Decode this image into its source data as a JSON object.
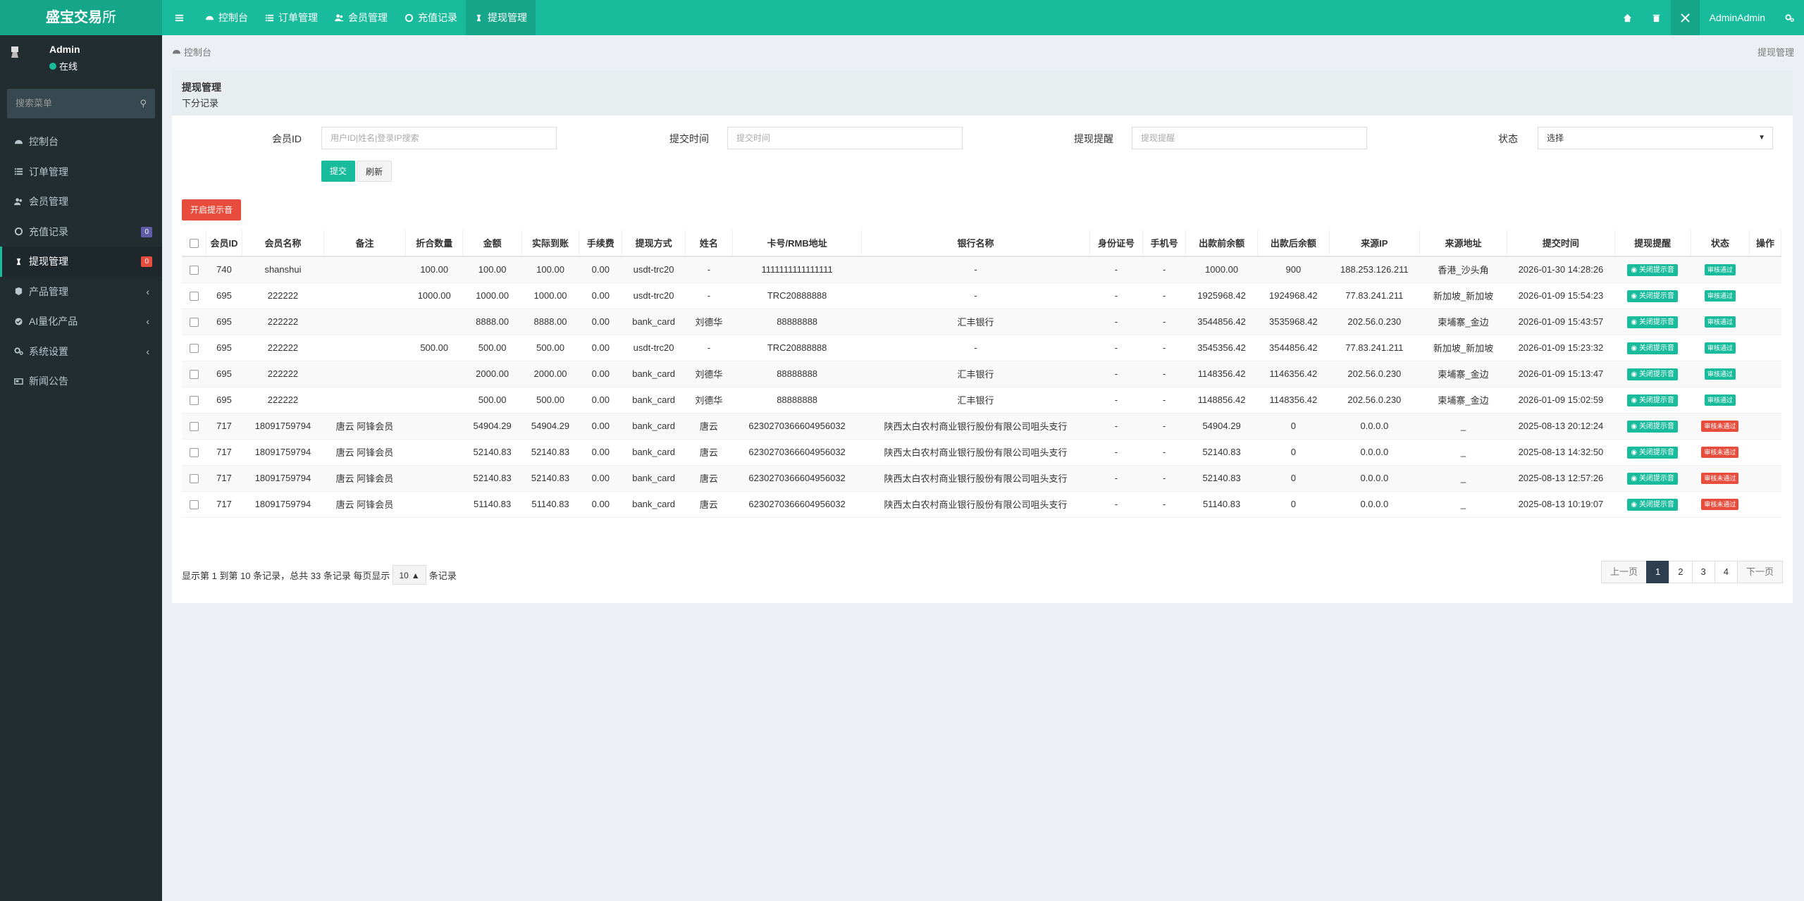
{
  "header": {
    "brand_bold": "盛宝交易",
    "brand_light": "所",
    "nav": [
      "控制台",
      "订单管理",
      "会员管理",
      "充值记录",
      "提现管理"
    ],
    "right_user": "AdminAdmin"
  },
  "sidebar": {
    "user_name": "Admin",
    "status": "在线",
    "search_placeholder": "搜索菜单",
    "items": [
      {
        "label": "控制台"
      },
      {
        "label": "订单管理"
      },
      {
        "label": "会员管理"
      },
      {
        "label": "充值记录",
        "badge": "0",
        "badge_color": "#605ca8"
      },
      {
        "label": "提现管理",
        "badge": "0",
        "badge_color": "#e74c3c"
      },
      {
        "label": "产品管理"
      },
      {
        "label": "AI量化产品"
      },
      {
        "label": "系统设置"
      },
      {
        "label": "新闻公告"
      }
    ]
  },
  "breadcrumb": {
    "home": "控制台",
    "current": "提现管理"
  },
  "panel": {
    "title": "提现管理",
    "subtitle": "下分记录"
  },
  "filters": {
    "member_id_label": "会员ID",
    "member_id_placeholder": "用户ID|姓名|登录IP搜索",
    "time_label": "提交时间",
    "time_placeholder": "提交时间",
    "remind_label": "提现提醒",
    "remind_placeholder": "提现提醒",
    "status_label": "状态",
    "status_value": "选择",
    "submit": "提交",
    "refresh": "刷新"
  },
  "alert_button": "开启提示音",
  "table": {
    "headers": [
      "会员ID",
      "会员名称",
      "备注",
      "折合数量",
      "金额",
      "实际到账",
      "手续费",
      "提现方式",
      "姓名",
      "卡号/RMB地址",
      "银行名称",
      "身份证号",
      "手机号",
      "出款前余额",
      "出款后余额",
      "来源IP",
      "来源地址",
      "提交时间",
      "提现提醒",
      "状态",
      "操作"
    ],
    "remind_label": "关闭提示音",
    "rows": [
      {
        "id": "740",
        "name": "shanshui",
        "note": "",
        "convert": "100.00",
        "amount": "100.00",
        "actual": "100.00",
        "fee": "0.00",
        "method": "usdt-trc20",
        "realname": "-",
        "card": "1111111111111111",
        "bank": "-",
        "idcard": "-",
        "phone": "-",
        "before": "1000.00",
        "after": "900",
        "ip": "188.253.126.211",
        "addr": "香港_沙头角",
        "time": "2026-01-30 14:28:26",
        "status": "审核通过",
        "status_type": "ok"
      },
      {
        "id": "695",
        "name": "222222",
        "note": "",
        "convert": "1000.00",
        "amount": "1000.00",
        "actual": "1000.00",
        "fee": "0.00",
        "method": "usdt-trc20",
        "realname": "-",
        "card": "TRC20888888",
        "bank": "-",
        "idcard": "-",
        "phone": "-",
        "before": "1925968.42",
        "after": "1924968.42",
        "ip": "77.83.241.211",
        "addr": "新加坡_新加坡",
        "time": "2026-01-09 15:54:23",
        "status": "审核通过",
        "status_type": "ok"
      },
      {
        "id": "695",
        "name": "222222",
        "note": "",
        "convert": "",
        "amount": "8888.00",
        "actual": "8888.00",
        "fee": "0.00",
        "method": "bank_card",
        "realname": "刘德华",
        "card": "88888888",
        "bank": "汇丰银行",
        "idcard": "-",
        "phone": "-",
        "before": "3544856.42",
        "after": "3535968.42",
        "ip": "202.56.0.230",
        "addr": "柬埔寨_金边",
        "time": "2026-01-09 15:43:57",
        "status": "审核通过",
        "status_type": "ok"
      },
      {
        "id": "695",
        "name": "222222",
        "note": "",
        "convert": "500.00",
        "amount": "500.00",
        "actual": "500.00",
        "fee": "0.00",
        "method": "usdt-trc20",
        "realname": "-",
        "card": "TRC20888888",
        "bank": "-",
        "idcard": "-",
        "phone": "-",
        "before": "3545356.42",
        "after": "3544856.42",
        "ip": "77.83.241.211",
        "addr": "新加坡_新加坡",
        "time": "2026-01-09 15:23:32",
        "status": "审核通过",
        "status_type": "ok"
      },
      {
        "id": "695",
        "name": "222222",
        "note": "",
        "convert": "",
        "amount": "2000.00",
        "actual": "2000.00",
        "fee": "0.00",
        "method": "bank_card",
        "realname": "刘德华",
        "card": "88888888",
        "bank": "汇丰银行",
        "idcard": "-",
        "phone": "-",
        "before": "1148356.42",
        "after": "1146356.42",
        "ip": "202.56.0.230",
        "addr": "柬埔寨_金边",
        "time": "2026-01-09 15:13:47",
        "status": "审核通过",
        "status_type": "ok"
      },
      {
        "id": "695",
        "name": "222222",
        "note": "",
        "convert": "",
        "amount": "500.00",
        "actual": "500.00",
        "fee": "0.00",
        "method": "bank_card",
        "realname": "刘德华",
        "card": "88888888",
        "bank": "汇丰银行",
        "idcard": "-",
        "phone": "-",
        "before": "1148856.42",
        "after": "1148356.42",
        "ip": "202.56.0.230",
        "addr": "柬埔寨_金边",
        "time": "2026-01-09 15:02:59",
        "status": "审核通过",
        "status_type": "ok"
      },
      {
        "id": "717",
        "name": "18091759794",
        "note": "唐云 阿锋会员",
        "convert": "",
        "amount": "54904.29",
        "actual": "54904.29",
        "fee": "0.00",
        "method": "bank_card",
        "realname": "唐云",
        "card": "6230270366604956032",
        "bank": "陕西太白农村商业银行股份有限公司咀头支行",
        "idcard": "-",
        "phone": "-",
        "before": "54904.29",
        "after": "0",
        "ip": "0.0.0.0",
        "addr": "_",
        "time": "2025-08-13 20:12:24",
        "status": "审核未通过",
        "status_type": "fail"
      },
      {
        "id": "717",
        "name": "18091759794",
        "note": "唐云 阿锋会员",
        "convert": "",
        "amount": "52140.83",
        "actual": "52140.83",
        "fee": "0.00",
        "method": "bank_card",
        "realname": "唐云",
        "card": "6230270366604956032",
        "bank": "陕西太白农村商业银行股份有限公司咀头支行",
        "idcard": "-",
        "phone": "-",
        "before": "52140.83",
        "after": "0",
        "ip": "0.0.0.0",
        "addr": "_",
        "time": "2025-08-13 14:32:50",
        "status": "审核未通过",
        "status_type": "fail"
      },
      {
        "id": "717",
        "name": "18091759794",
        "note": "唐云 阿锋会员",
        "convert": "",
        "amount": "52140.83",
        "actual": "52140.83",
        "fee": "0.00",
        "method": "bank_card",
        "realname": "唐云",
        "card": "6230270366604956032",
        "bank": "陕西太白农村商业银行股份有限公司咀头支行",
        "idcard": "-",
        "phone": "-",
        "before": "52140.83",
        "after": "0",
        "ip": "0.0.0.0",
        "addr": "_",
        "time": "2025-08-13 12:57:26",
        "status": "审核未通过",
        "status_type": "fail"
      },
      {
        "id": "717",
        "name": "18091759794",
        "note": "唐云 阿锋会员",
        "convert": "",
        "amount": "51140.83",
        "actual": "51140.83",
        "fee": "0.00",
        "method": "bank_card",
        "realname": "唐云",
        "card": "6230270366604956032",
        "bank": "陕西太白农村商业银行股份有限公司咀头支行",
        "idcard": "-",
        "phone": "-",
        "before": "51140.83",
        "after": "0",
        "ip": "0.0.0.0",
        "addr": "_",
        "time": "2025-08-13 10:19:07",
        "status": "审核未通过",
        "status_type": "fail"
      }
    ]
  },
  "footer": {
    "info_prefix": "显示第 1 到第 10 条记录，总共 33 条记录 每页显示",
    "page_size": "10",
    "info_suffix": "条记录",
    "prev": "上一页",
    "pages": [
      "1",
      "2",
      "3",
      "4"
    ],
    "next": "下一页"
  }
}
